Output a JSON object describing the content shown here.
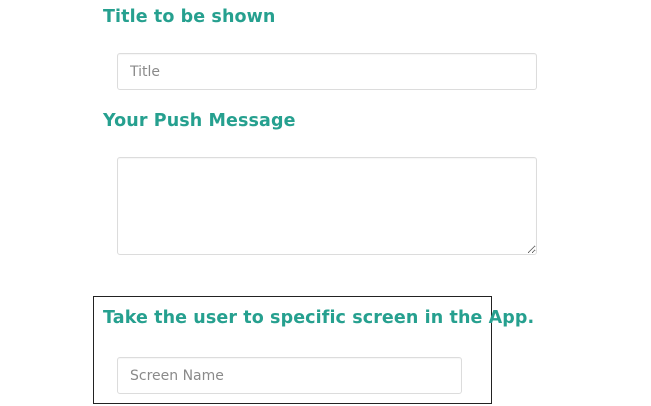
{
  "form": {
    "title_section": {
      "label": "Title to be shown",
      "input_placeholder": "Title",
      "input_value": ""
    },
    "message_section": {
      "label": "Your Push Message",
      "textarea_value": ""
    },
    "screen_section": {
      "label": "Take the user to specific screen in the App.",
      "input_placeholder": "Screen Name",
      "input_value": ""
    }
  },
  "colors": {
    "label_teal": "#26a08f",
    "input_border": "#dcdcdc",
    "placeholder_gray": "#8a8a8a",
    "box_border": "#222222"
  }
}
